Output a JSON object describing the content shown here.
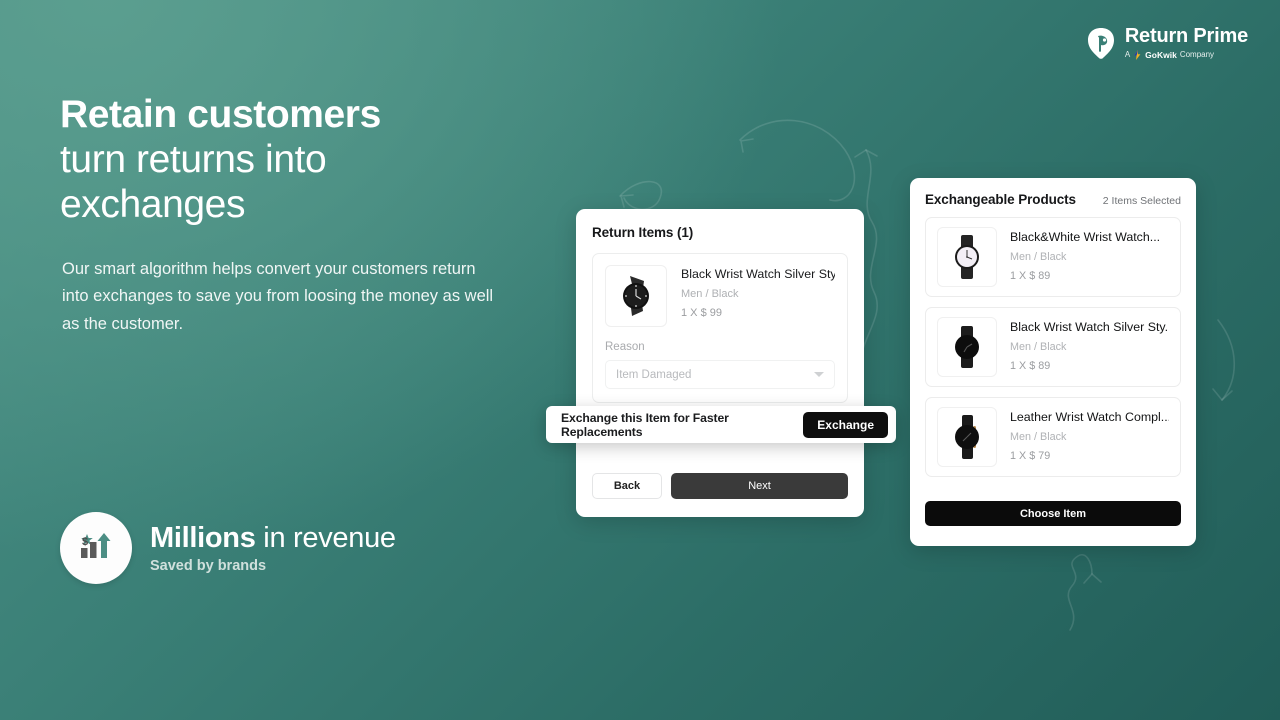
{
  "brand": {
    "logo_icon": "return-prime-mark-icon",
    "title": "Return Prime",
    "sub_prefix": "A",
    "sub_brand": "GoKwik",
    "sub_suffix": "Company",
    "gokwik_icon": "gokwik-bolt-icon"
  },
  "hero": {
    "headline_bold": "Retain customers",
    "headline_line2": "turn returns into",
    "headline_line3": "exchanges",
    "paragraph": "Our smart algorithm helps convert your customers return into exchanges to save you from loosing the money as well as the customer."
  },
  "revenue_badge": {
    "icon": "revenue-growth-chart-icon",
    "amount": "Millions",
    "amount_suffix": " in revenue",
    "caption_prefix": "Saved by ",
    "caption_bold": "brands"
  },
  "return_card": {
    "title": "Return Items (1)",
    "item": {
      "image_icon": "black-wrist-watch-thumbnail",
      "name": "Black Wrist Watch Silver Sty...",
      "variant": "Men / Black",
      "price": "1 X $ 99"
    },
    "reason_label": "Reason",
    "reason_value": "Item Damaged",
    "reason_caret_icon": "chevron-down-icon",
    "back_label": "Back",
    "next_label": "Next"
  },
  "exchange_banner": {
    "message": "Exchange this Item for Faster Replacements",
    "button_label": "Exchange"
  },
  "exchange_card": {
    "title": "Exchangeable Products",
    "selected_count": "2 Items Selected",
    "products": [
      {
        "image_icon": "white-face-wrist-watch-thumbnail",
        "name": "Black&White Wrist Watch...",
        "variant": "Men / Black",
        "price": "1 X $ 89"
      },
      {
        "image_icon": "black-minimal-wrist-watch-thumbnail",
        "name": "Black Wrist Watch Silver Sty...",
        "variant": "Men / Black",
        "price": "1 X $ 89"
      },
      {
        "image_icon": "leather-strap-wrist-watch-thumbnail",
        "name": "Leather Wrist Watch Compl...",
        "variant": "Men / Black",
        "price": "1 X $ 79"
      }
    ],
    "choose_label": "Choose Item"
  },
  "colors": {
    "background_light": "#4c9287",
    "background_dark": "#215d58",
    "button_dark": "#0b0b0b",
    "next_button": "#3a3a3a"
  }
}
